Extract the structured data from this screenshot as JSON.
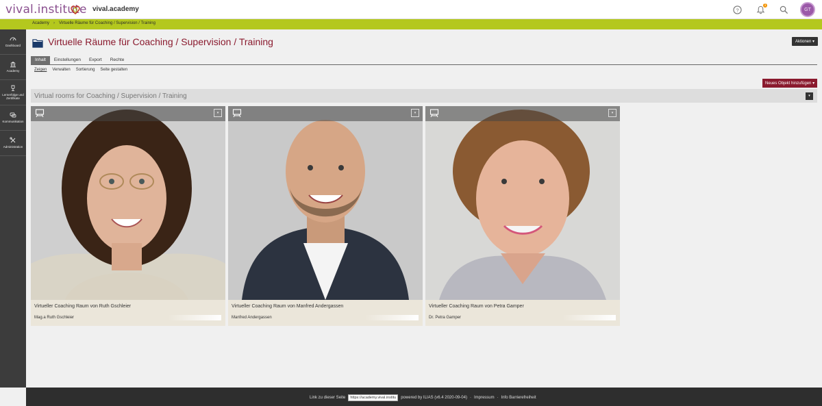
{
  "header": {
    "logo_text": "vival.institute",
    "site_name": "vival.academy",
    "notification_count": "1",
    "avatar_initials": "GT"
  },
  "breadcrumb": [
    "Academy",
    "Virtuelle Räume für Coaching / Supervision / Training"
  ],
  "sidebar": {
    "items": [
      {
        "label": "Dashboard",
        "icon": "dashboard-icon"
      },
      {
        "label": "Academy",
        "icon": "bank-icon"
      },
      {
        "label": "Lernerfolge und Zertifikate",
        "icon": "trophy-icon"
      },
      {
        "label": "Kommunikation",
        "icon": "chat-icon"
      },
      {
        "label": "Administration",
        "icon": "tools-icon"
      }
    ]
  },
  "page": {
    "title": "Virtuelle Räume für Coaching / Supervision / Training",
    "actions_label": "Aktionen",
    "tabs": [
      "Inhalt",
      "Einstellungen",
      "Export",
      "Rechte"
    ],
    "subtabs": [
      "Zeigen",
      "Verwalten",
      "Sortierung",
      "Seite gestalten"
    ],
    "new_object_label": "Neues Objekt hinzufügen",
    "block_title": "Virtual rooms for Coaching / Supervision / Training"
  },
  "cards": [
    {
      "title": "Virtueller Coaching Raum von Ruth Gschleier",
      "name": "Mag.a Ruth Gschleier"
    },
    {
      "title": "Virtueller Coaching Raum von Manfred Andergassen",
      "name": "Manfred Andergassen"
    },
    {
      "title": "Virtueller Coaching Raum von Petra Gamper",
      "name": "Dr. Petra Gamper"
    }
  ],
  "footer": {
    "link_label": "Link zu dieser Seite",
    "link_value": "https://academy.vival.institu",
    "powered": "powered by ILIAS (v6.4 2020-09-04)",
    "impressum": "Impressum",
    "accessibility": "Info Barrierefreiheit"
  },
  "colors": {
    "brand_purple": "#8a4f8f",
    "accent_green": "#b4c81e",
    "title_red": "#8a1a2e",
    "sidebar_dark": "#3c3c3c"
  }
}
